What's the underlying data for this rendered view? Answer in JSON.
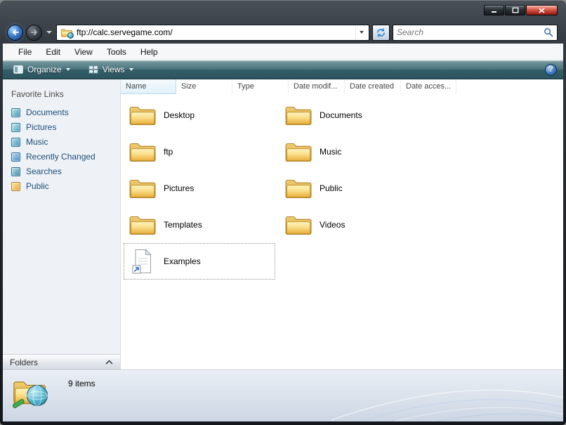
{
  "colors": {
    "titlebar_dark": "#262c33",
    "toolbar_teal": "#4a747e",
    "sidebar_bg": "#eef1f5",
    "link_text_blue": "#1b4d7b",
    "folder_yellow": "#f2c14e",
    "close_button_red": "#c0392b",
    "name_header_highlight": "#e2f1fa"
  },
  "titlebar": {
    "controls": [
      {
        "name": "minimize",
        "icon": "minimize-icon"
      },
      {
        "name": "maximize",
        "icon": "maximize-icon"
      },
      {
        "name": "close",
        "icon": "close-icon"
      }
    ]
  },
  "address_bar": {
    "value": "ftp://calc.servegame.com/",
    "site_icon": "ftp-folder-globe-icon",
    "back_icon": "back-arrow-icon",
    "forward_icon": "forward-arrow-icon",
    "refresh_icon": "refresh-icon",
    "search_placeholder": "Search",
    "search_icon": "search-magnifier-icon"
  },
  "menu_bar": {
    "items": [
      "File",
      "Edit",
      "View",
      "Tools",
      "Help"
    ]
  },
  "toolbar": {
    "organize_label": "Organize",
    "organize_icon": "organize-icon",
    "views_label": "Views",
    "views_icon": "views-icon",
    "help_glyph": "?"
  },
  "sidebar": {
    "title": "Favorite Links",
    "items": [
      {
        "label": "Documents",
        "icon": "documents-icon"
      },
      {
        "label": "Pictures",
        "icon": "pictures-icon"
      },
      {
        "label": "Music",
        "icon": "music-icon"
      },
      {
        "label": "Recently Changed",
        "icon": "recently-changed-icon"
      },
      {
        "label": "Searches",
        "icon": "searches-icon"
      },
      {
        "label": "Public",
        "icon": "public-folder-icon"
      }
    ],
    "folders_label": "Folders",
    "folders_chevron_icon": "chevron-up-icon"
  },
  "file_list": {
    "columns": [
      "Name",
      "Size",
      "Type",
      "Date modif...",
      "Date created",
      "Date acces..."
    ],
    "items": [
      {
        "name": "Desktop",
        "kind": "folder"
      },
      {
        "name": "Documents",
        "kind": "folder"
      },
      {
        "name": "ftp",
        "kind": "folder"
      },
      {
        "name": "Music",
        "kind": "folder"
      },
      {
        "name": "Pictures",
        "kind": "folder"
      },
      {
        "name": "Public",
        "kind": "folder"
      },
      {
        "name": "Templates",
        "kind": "folder"
      },
      {
        "name": "Videos",
        "kind": "folder"
      },
      {
        "name": "Examples",
        "kind": "file-shortcut",
        "selected": true
      }
    ]
  },
  "status_bar": {
    "items_count": "9 items",
    "icon": "ftp-folder-globe-icon"
  }
}
